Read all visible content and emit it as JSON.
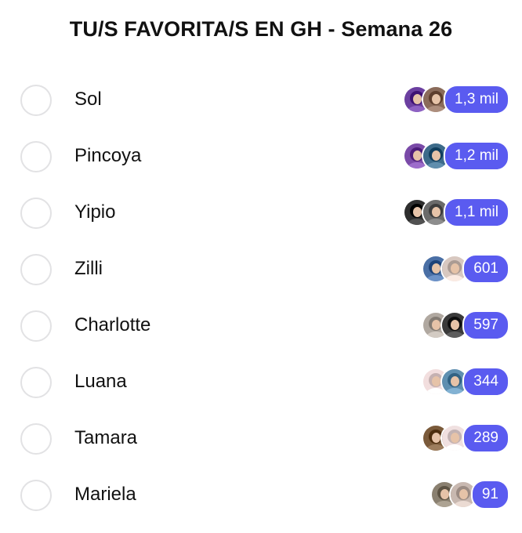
{
  "poll": {
    "title": "TU/S FAVORITA/S EN GH - Semana 26",
    "options": [
      {
        "label": "Sol",
        "count": "1,3 mil",
        "avatars": [
          "#6b3fa0",
          "#8a6b5a"
        ]
      },
      {
        "label": "Pincoya",
        "count": "1,2 mil",
        "avatars": [
          "#7a4aa8",
          "#3d6b8a"
        ]
      },
      {
        "label": "Yipio",
        "count": "1,1 mil",
        "avatars": [
          "#2e2e2e",
          "#6a6a6a"
        ]
      },
      {
        "label": "Zilli",
        "count": "601",
        "avatars": [
          "#4a6fa5",
          "#d8c8c0"
        ]
      },
      {
        "label": "Charlotte",
        "count": "597",
        "avatars": [
          "#b0a8a0",
          "#3a3a3a"
        ]
      },
      {
        "label": "Luana",
        "count": "344",
        "avatars": [
          "#f2dede",
          "#5f8fb0"
        ]
      },
      {
        "label": "Tamara",
        "count": "289",
        "avatars": [
          "#7a5a3a",
          "#f0e0e0"
        ]
      },
      {
        "label": "Mariela",
        "count": "91",
        "avatars": [
          "#8a8070",
          "#c8b8b0"
        ]
      }
    ]
  },
  "colors": {
    "count_pill": "#5a5bf0",
    "radio_border": "#e2e2e4"
  }
}
